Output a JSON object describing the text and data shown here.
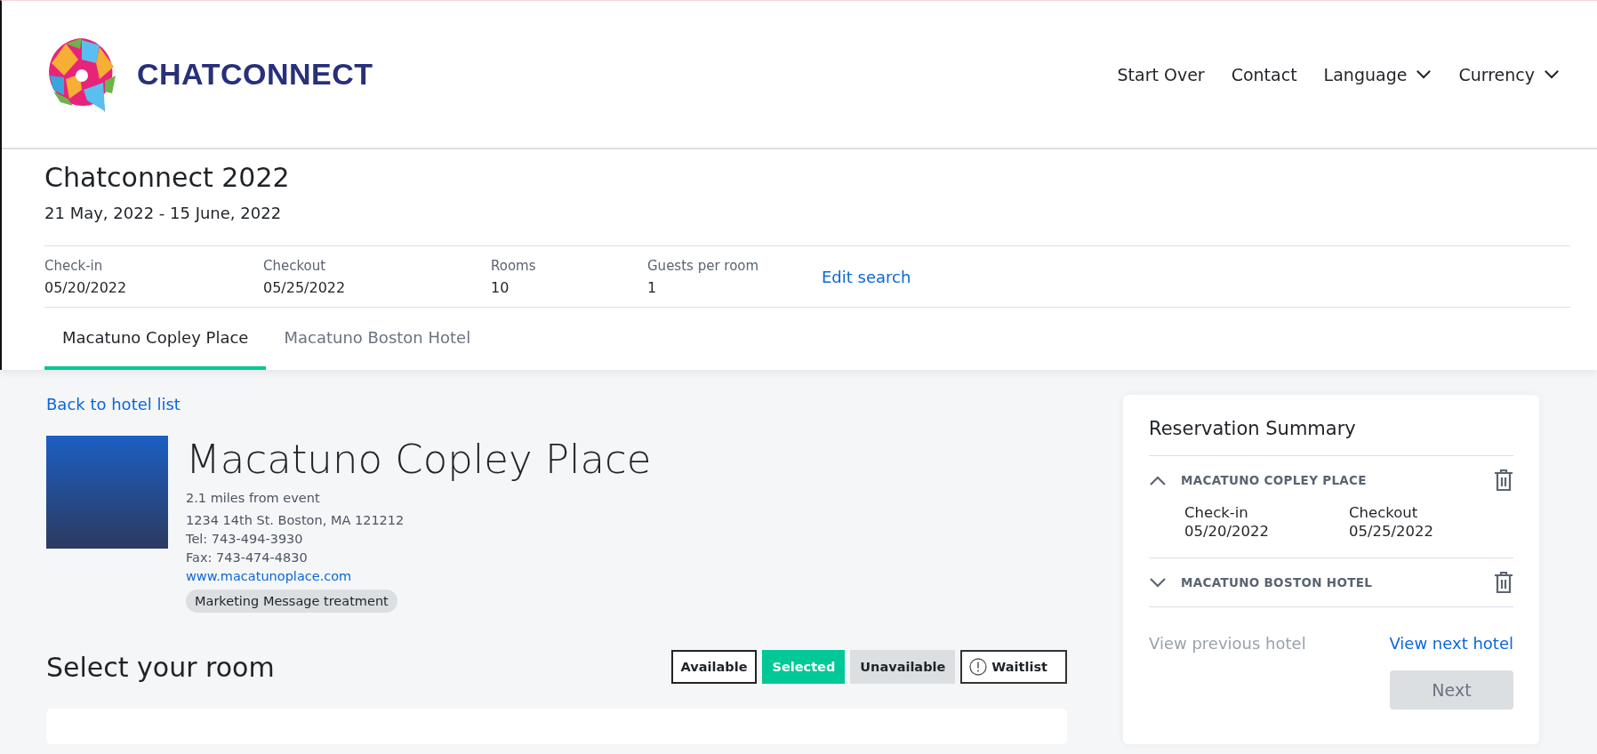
{
  "brand": {
    "name": "CHATCONNECT"
  },
  "nav": [
    {
      "label": "Start Over",
      "kind": "link"
    },
    {
      "label": "Contact",
      "kind": "link"
    },
    {
      "label": "Language",
      "kind": "dropdown"
    },
    {
      "label": "Currency",
      "kind": "dropdown"
    }
  ],
  "event": {
    "title": "Chatconnect 2022",
    "dates": "21 May, 2022 - 15 June, 2022"
  },
  "search": {
    "fields": [
      {
        "label": "Check-in",
        "value": "05/20/2022"
      },
      {
        "label": "Checkout",
        "value": "05/25/2022"
      },
      {
        "label": "Rooms",
        "value": "10"
      },
      {
        "label": "Guests per room",
        "value": "1"
      }
    ],
    "edit_link": "Edit search"
  },
  "tabs": [
    {
      "label": "Macatuno Copley Place",
      "selected": true
    },
    {
      "label": "Macatuno Boston Hotel",
      "selected": false
    }
  ],
  "back_link": "Back to hotel list",
  "hotel": {
    "name": "Macatuno Copley Place",
    "distance": "2.1 miles from event",
    "address": "1234 14th St. Boston, MA 121212",
    "tel": "Tel: 743-494-3930",
    "fax": "Fax: 743-474-4830",
    "website": "www.macatunoplace.com",
    "tag": "Marketing Message treatment"
  },
  "rooms": {
    "title": "Select your room",
    "legend": [
      {
        "label": "Available",
        "kind": "available"
      },
      {
        "label": "Selected",
        "kind": "selected"
      },
      {
        "label": "Unavailable",
        "kind": "unavailable"
      },
      {
        "label": "Waitlist",
        "kind": "waitlist"
      }
    ]
  },
  "summary": {
    "title": "Reservation Summary",
    "hotels": [
      {
        "name": "MACATUNO COPLEY PLACE",
        "expanded": true,
        "dates": [
          {
            "label": "Check-in",
            "value": "05/20/2022"
          },
          {
            "label": "Checkout",
            "value": "05/25/2022"
          }
        ]
      },
      {
        "name": "MACATUNO BOSTON HOTEL",
        "expanded": false
      }
    ],
    "previous": {
      "label": "View previous hotel",
      "disabled": true
    },
    "next_link": {
      "label": "View next hotel",
      "disabled": false
    },
    "next_button": {
      "label": "Next",
      "disabled": true
    }
  }
}
